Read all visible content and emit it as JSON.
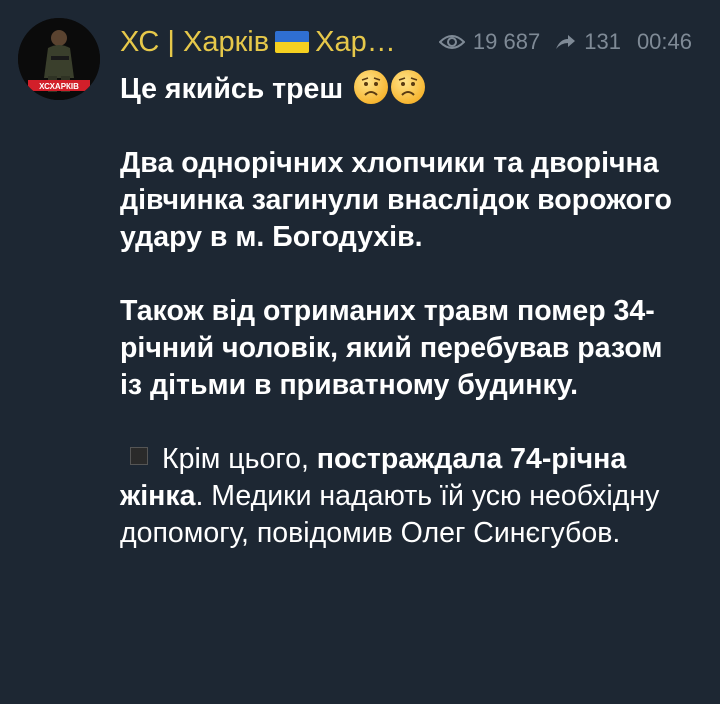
{
  "channel": {
    "name_prefix": "ХС | Харків",
    "name_suffix": "Хар…",
    "avatar_label": "ХСХАРКІВ"
  },
  "meta": {
    "views": "19 687",
    "shares": "131",
    "time": "00:46"
  },
  "message": {
    "line1": "Це якийсь треш",
    "para1": "Два однорічних хлопчики та дворічна дівчинка загинули внаслідок ворожого удару в м. Богодухів.",
    "para2": "Також від отриманих травм помер 34-річний чоловік, який перебував разом із дітьми в приватному будинку.",
    "para3_prefix": "Крім цього, ",
    "para3_bold": "постраждала 74-річна жінка",
    "para3_suffix": ". Медики надають їй усю необхідну допомогу, повідомив Олег Синєгубов."
  },
  "icons": {
    "views": "eye-icon",
    "shares": "share-arrow-icon",
    "emoji": "worried-face-emoji",
    "bullet": "black-square-icon"
  },
  "colors": {
    "background": "#1d2733",
    "channel_name": "#e6c84a",
    "meta_text": "#7f8a96",
    "message_text": "#ffffff"
  }
}
